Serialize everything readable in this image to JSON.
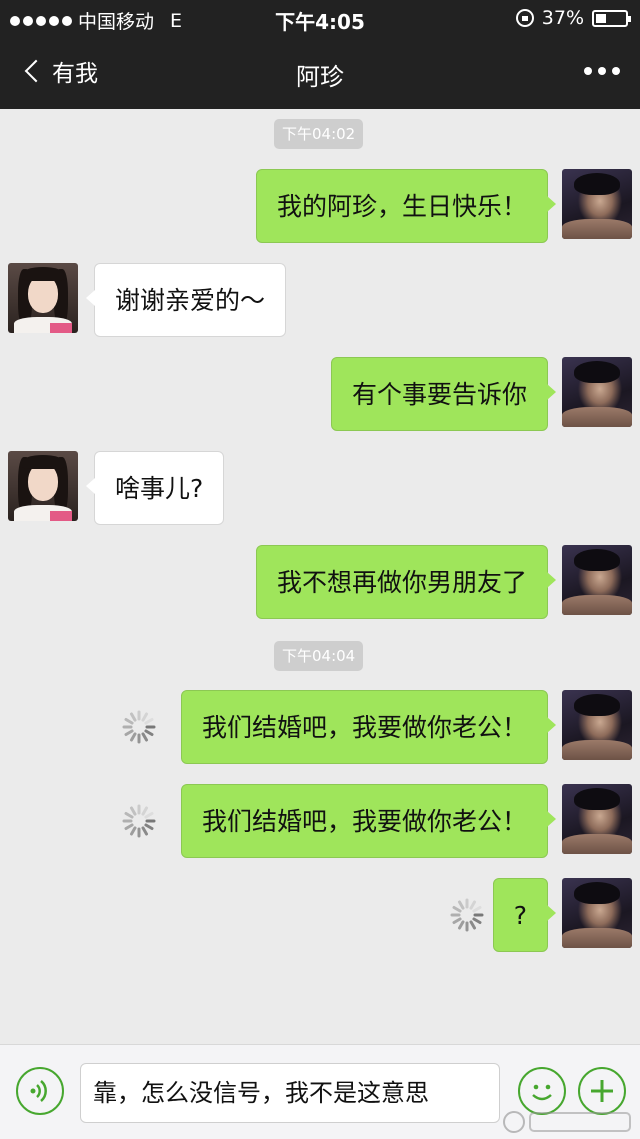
{
  "status_bar": {
    "carrier": "中国移动",
    "network": "E",
    "time": "下午4:05",
    "battery_percent": "37%",
    "battery_level": 0.37
  },
  "nav": {
    "back_label": "有我",
    "title": "阿珍",
    "back_icon": "chevron-left-icon",
    "more_icon": "more-icon"
  },
  "timestamps": [
    "下午04:02",
    "下午04:04"
  ],
  "messages": [
    {
      "direction": "outgoing",
      "text": "我的阿珍，生日快乐！",
      "status": "sent"
    },
    {
      "direction": "incoming",
      "text": "谢谢亲爱的～",
      "status": "received"
    },
    {
      "direction": "outgoing",
      "text": "有个事要告诉你",
      "status": "sent"
    },
    {
      "direction": "incoming",
      "text": "啥事儿?",
      "status": "received"
    },
    {
      "direction": "outgoing",
      "text": "我不想再做你男朋友了",
      "status": "sent"
    },
    {
      "direction": "outgoing",
      "text": "我们结婚吧，我要做你老公！",
      "status": "sending"
    },
    {
      "direction": "outgoing",
      "text": "我们结婚吧，我要做你老公！",
      "status": "sending"
    },
    {
      "direction": "outgoing",
      "text": "?",
      "status": "sending"
    }
  ],
  "input_bar": {
    "text": "靠，怎么没信号，我不是这意思",
    "voice_icon": "voice-icon",
    "emoji_icon": "emoji-icon",
    "plus_icon": "plus-icon"
  },
  "colors": {
    "top_bar": "#222222",
    "chat_background": "#ebebeb",
    "outgoing_bubble": "#9fe55b",
    "incoming_bubble": "#ffffff",
    "timestamp_pill": "#cecece",
    "accent_green": "#47a72f"
  }
}
